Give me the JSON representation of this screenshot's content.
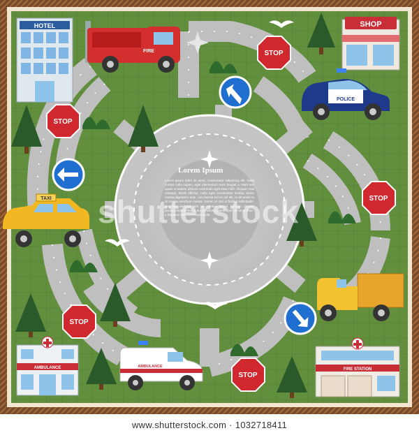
{
  "board": {
    "center_title": "Lorem Ipsum",
    "center_body": "Lorem ipsum dolor sit amet, consectetur adipiscing elit. Nulla cursus nulla sapien, eget elementum nunc feugiat a. Nam sed quam ut sapien ultrices commodo eget vitae nibh. Aliquam erat volutpat. Morbi efficitur, nulla eget consectetur lacinia, lorem massa dignissim ante, non lacinia est ex vel elit. In sit amet ex ut massa interdum massa. Donec et nisl ut finibus sollicitudin. Sed non eleifend nibh, ac pulvinar ipsum. Aenean ultrices, purus condimentum a dui et rutrum ullamcorper, sit amet nunc, a faucibus nibh lorem quis nulla."
  },
  "buildings": {
    "hotel": "HOTEL",
    "shop": "SHOP",
    "ambulance": "AMBULANCE",
    "fire_station": "FIRE STATION"
  },
  "vehicles": {
    "fire_truck": "FIRE",
    "police": "POLICE",
    "taxi": "TAXI",
    "ambulance": "AMBULANCE"
  },
  "signs": {
    "stop": "STOP"
  },
  "watermark": "shutterstock",
  "footer": "www.shutterstock.com · 1032718411",
  "colors": {
    "grass": "#5e8a3a",
    "road": "#bdbdbd",
    "frame": "#7a4b2a",
    "stop_red": "#d0282e",
    "direction_blue": "#1f6fd1"
  }
}
